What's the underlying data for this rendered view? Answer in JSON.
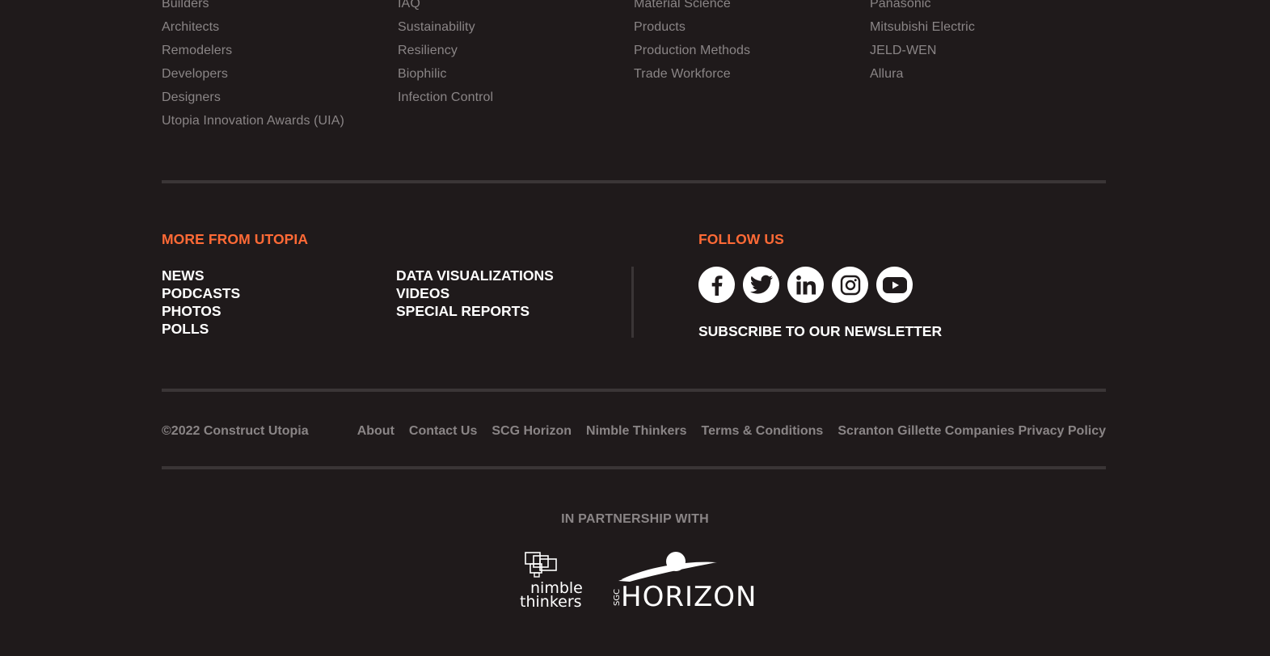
{
  "columns": [
    [
      "Builders",
      "Architects",
      "Remodelers",
      "Developers",
      "Designers",
      "Utopia Innovation Awards (UIA)"
    ],
    [
      "IAQ",
      "Sustainability",
      "Resiliency",
      "Biophilic",
      "Infection Control"
    ],
    [
      "Material Science",
      "Products",
      "Production Methods",
      "Trade Workforce"
    ],
    [
      "Panasonic",
      "Mitsubishi Electric",
      "JELD-WEN",
      "Allura"
    ]
  ],
  "more": {
    "title": "MORE FROM UTOPIA",
    "left_links": [
      "NEWS",
      "PODCASTS",
      "PHOTOS",
      "POLLS"
    ],
    "right_links": [
      "DATA VISUALIZATIONS",
      "VIDEOS",
      "SPECIAL REPORTS"
    ]
  },
  "follow": {
    "title": "FOLLOW US",
    "icons": [
      "facebook-icon",
      "twitter-icon",
      "linkedin-icon",
      "instagram-icon",
      "youtube-icon"
    ],
    "subscribe_label": "SUBSCRIBE TO OUR NEWSLETTER"
  },
  "footer": {
    "copyright": "©2022 Construct Utopia",
    "links": [
      "About",
      "Contact Us",
      "SCG Horizon",
      "Nimble Thinkers",
      "Terms & Conditions",
      "Scranton Gillette Companies Privacy Policy"
    ]
  },
  "partnership": {
    "label": "IN PARTNERSHIP WITH",
    "nimble_line1": "nimble",
    "nimble_line2": "thinkers",
    "horizon_prefix": "SGC",
    "horizon_word": "HORIZON"
  },
  "colors": {
    "background": "#1f1a1b",
    "accent": "#ff6a36",
    "muted_text": "#8a8586",
    "rule": "#3a3536"
  }
}
